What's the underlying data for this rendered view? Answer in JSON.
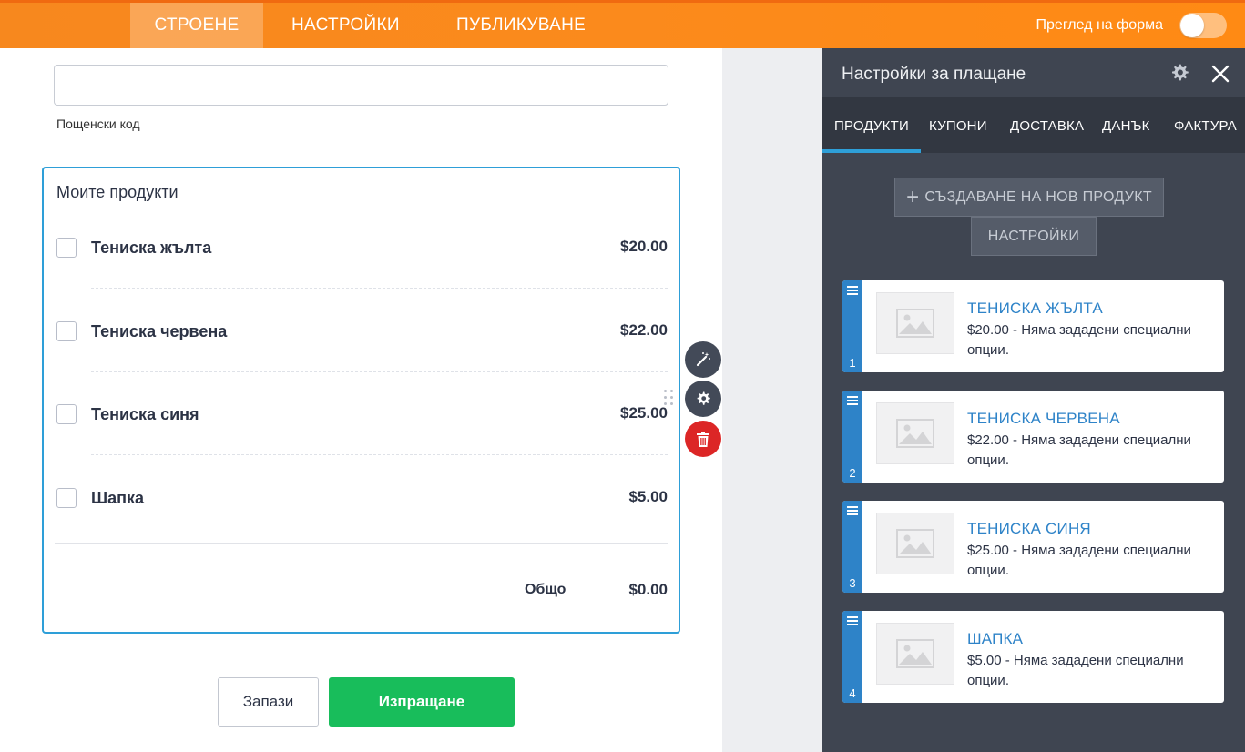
{
  "topbar": {
    "tabs": [
      {
        "label": "СТРОЕНЕ",
        "active": true
      },
      {
        "label": "НАСТРОЙКИ",
        "active": false
      },
      {
        "label": "ПУБЛИКУВАНЕ",
        "active": false
      }
    ],
    "preview_label": "Преглед на форма",
    "preview_enabled": false,
    "accent_color": "#ff8a14"
  },
  "form": {
    "zip_input_value": "",
    "zip_label": "Пощенски код",
    "products_title": "Моите продукти",
    "products": [
      {
        "name": "Тениска жълта",
        "price": "$20.00",
        "checked": false
      },
      {
        "name": "Тениска червена",
        "price": "$22.00",
        "checked": false
      },
      {
        "name": "Тениска синя",
        "price": "$25.00",
        "checked": false
      },
      {
        "name": "Шапка",
        "price": "$5.00",
        "checked": false
      }
    ],
    "total_label": "Общо",
    "total_value": "$0.00",
    "save_label": "Запази",
    "submit_label": "Изпращане",
    "submit_color": "#18bd5b"
  },
  "field_tools": [
    "magic-wand-icon",
    "gear-icon",
    "trash-icon"
  ],
  "panel": {
    "title": "Настройки за плащане",
    "tabs": [
      {
        "label": "ПРОДУКТИ",
        "active": true
      },
      {
        "label": "КУПОНИ",
        "active": false
      },
      {
        "label": "ДОСТАВКА",
        "active": false
      },
      {
        "label": "ДАНЪК",
        "active": false
      },
      {
        "label": "ФАКТУРА",
        "active": false
      }
    ],
    "new_product_label": "СЪЗДАВАНЕ НА НОВ ПРОДУКТ",
    "settings_label": "НАСТРОЙКИ",
    "cards": [
      {
        "index": "1",
        "name": "ТЕНИСКА ЖЪЛТА",
        "desc": "$20.00 - Няма зададени специални опции."
      },
      {
        "index": "2",
        "name": "ТЕНИСКА ЧЕРВЕНА",
        "desc": "$22.00 - Няма зададени специални опции."
      },
      {
        "index": "3",
        "name": "ТЕНИСКА СИНЯ",
        "desc": "$25.00 - Няма зададени специални опции."
      },
      {
        "index": "4",
        "name": "ШАПКА",
        "desc": "$5.00 - Няма зададени специални опции."
      }
    ]
  }
}
